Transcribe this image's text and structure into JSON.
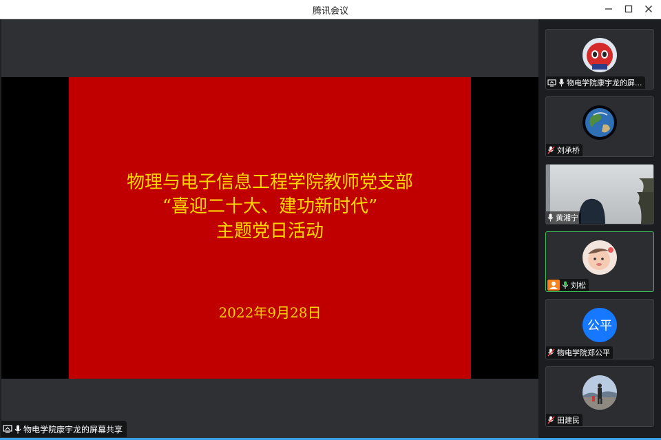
{
  "window": {
    "title": "腾讯会议"
  },
  "slide": {
    "lines": [
      "物理与电子信息工程学院教师党支部",
      "“喜迎二十大、建功新时代”",
      "主题党日活动"
    ],
    "date": "2022年9月28日"
  },
  "share_label": "物电学院康宇龙的屏幕共享",
  "participants": [
    {
      "name": "物电学院康宇龙的屏...",
      "mic": "on",
      "sharing": true,
      "avatar": "spiderman-avatar"
    },
    {
      "name": "刘承桥",
      "mic": "muted",
      "avatar": "earth-avatar"
    },
    {
      "name": "黄湘宁",
      "mic": "on",
      "video": true
    },
    {
      "name": "刘松",
      "mic": "speaking",
      "avatar": "baby-avatar",
      "active": true
    },
    {
      "name": "物电学院郑公平",
      "mic": "muted",
      "initials": "公平"
    },
    {
      "name": "田建民",
      "mic": "muted",
      "avatar": "walking-avatar"
    }
  ],
  "colors": {
    "slide_bg": "#c00000",
    "slide_text": "#ffd700",
    "active_border": "#3ec35c",
    "initials_bg": "#1677ff"
  }
}
